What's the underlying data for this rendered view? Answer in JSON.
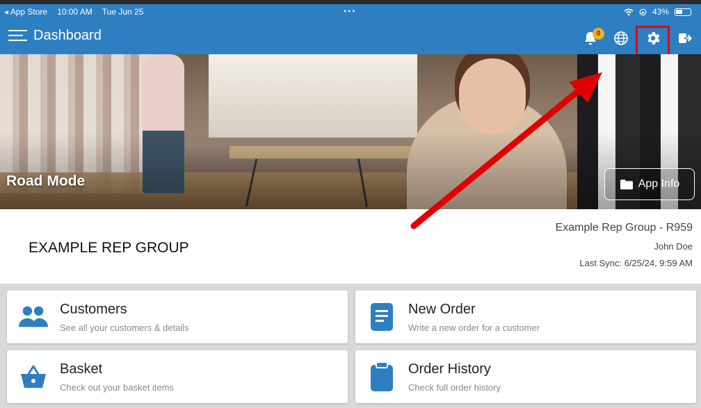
{
  "status_bar": {
    "back_app": "◂ App Store",
    "time": "10:00 AM",
    "date": "Tue Jun 25",
    "battery": "43%"
  },
  "header": {
    "title": "Dashboard",
    "notification_count": "0"
  },
  "hero": {
    "mode_label": "Road Mode",
    "app_info_label": "App Info"
  },
  "account": {
    "company_name": "EXAMPLE REP GROUP",
    "rep_group": "Example Rep Group - R959",
    "user_name": "John Doe",
    "last_sync": "Last Sync: 6/25/24, 9:59 AM"
  },
  "tiles": [
    {
      "title": "Customers",
      "subtitle": "See all your customers & details",
      "icon": "customers-icon"
    },
    {
      "title": "New Order",
      "subtitle": "Write a new order for a customer",
      "icon": "document-icon"
    },
    {
      "title": "Basket",
      "subtitle": "Check out your basket items",
      "icon": "basket-icon"
    },
    {
      "title": "Order History",
      "subtitle": "Check full order history",
      "icon": "clipboard-icon"
    }
  ],
  "colors": {
    "header_blue": "#2d7fc1",
    "accent_blue": "#2d7fc1",
    "badge_yellow": "#f2b01e",
    "annotation_red": "#e10000"
  }
}
